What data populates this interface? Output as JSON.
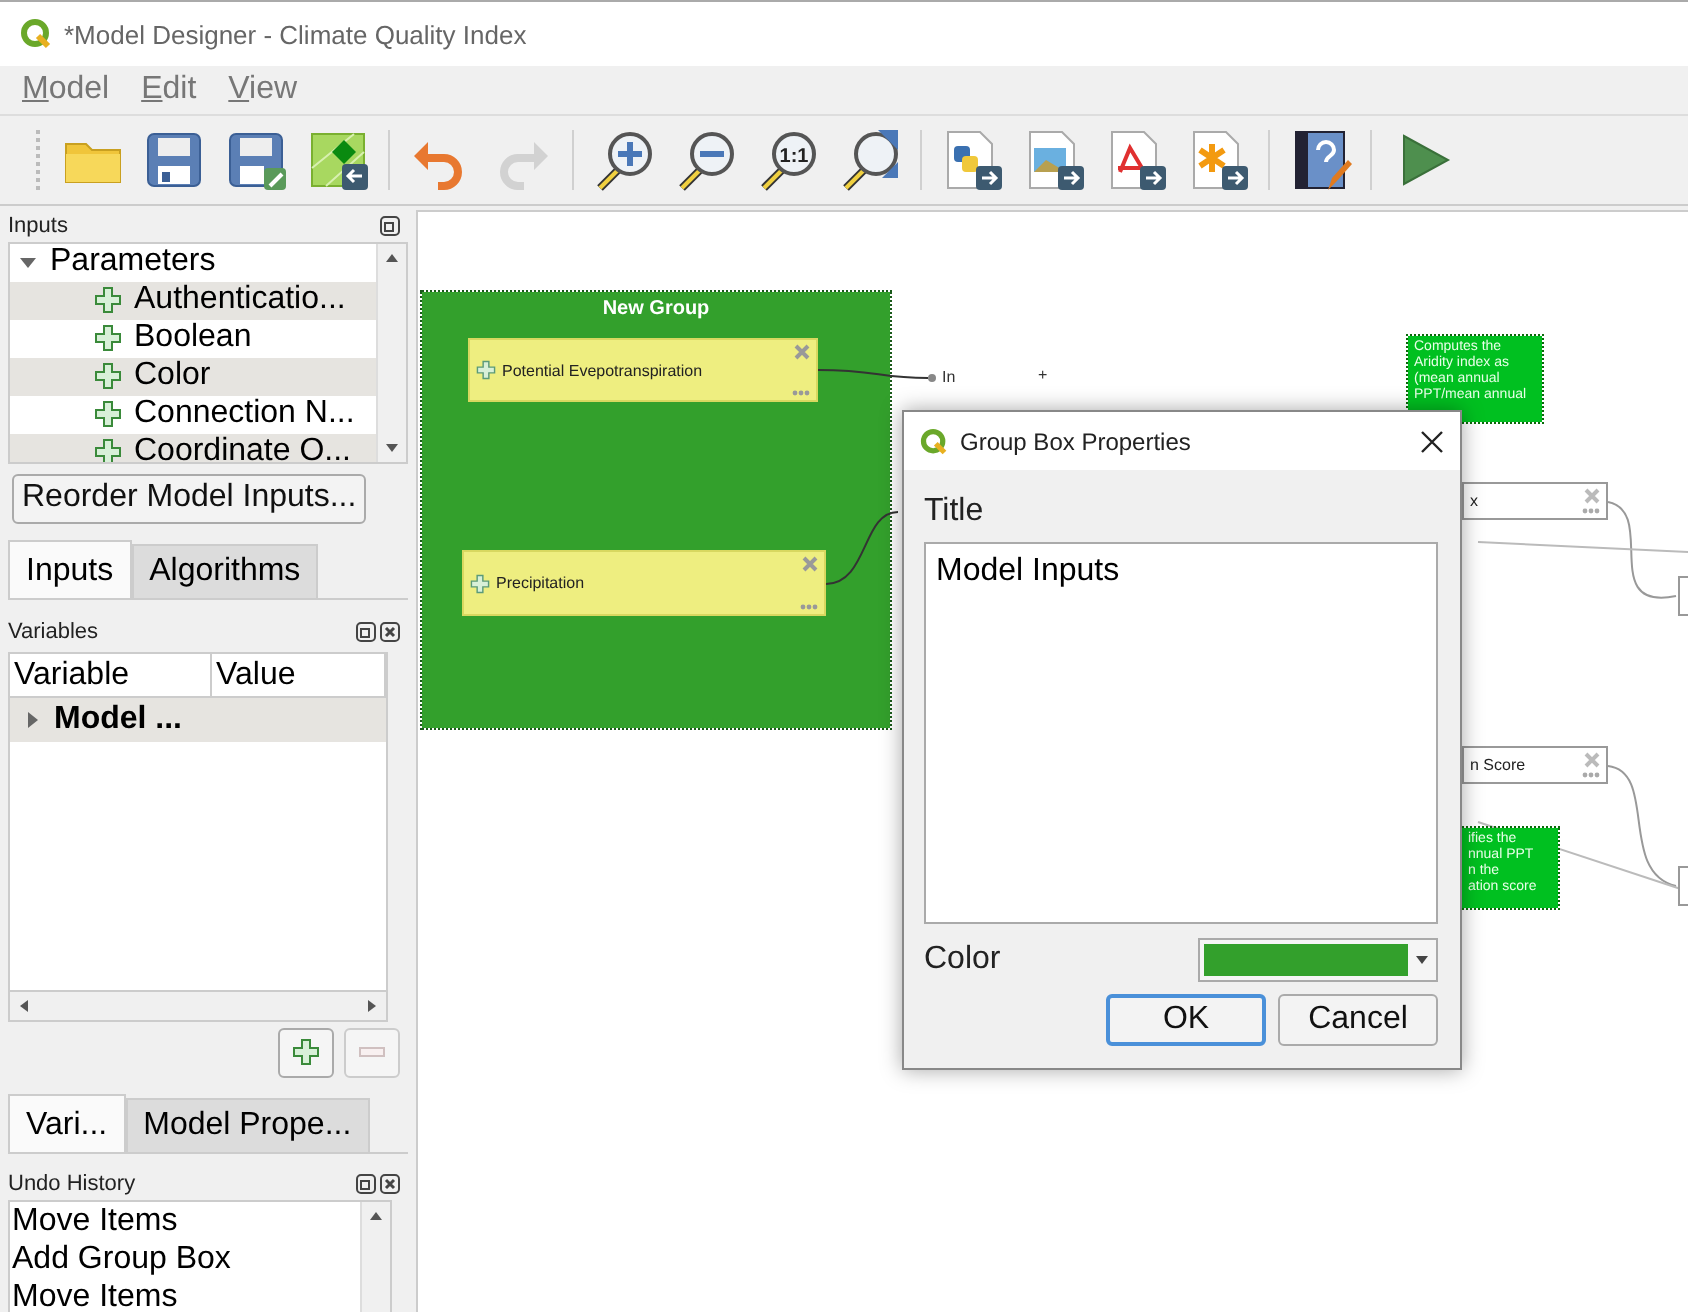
{
  "window": {
    "title": "*Model Designer - Climate Quality Index"
  },
  "menu": [
    "Model",
    "Edit",
    "View"
  ],
  "toolbar": [
    {
      "kind": "open",
      "disabled": false
    },
    {
      "kind": "save",
      "disabled": false
    },
    {
      "kind": "save-as",
      "disabled": false
    },
    {
      "kind": "export-model",
      "disabled": false
    },
    {
      "kind": "sep"
    },
    {
      "kind": "undo",
      "disabled": false
    },
    {
      "kind": "redo",
      "disabled": true
    },
    {
      "kind": "sep"
    },
    {
      "kind": "zoom-in",
      "disabled": false
    },
    {
      "kind": "zoom-out",
      "disabled": false
    },
    {
      "kind": "zoom-actual",
      "text": "1:1",
      "disabled": false
    },
    {
      "kind": "zoom-full",
      "disabled": false
    },
    {
      "kind": "sep"
    },
    {
      "kind": "export-python",
      "disabled": false
    },
    {
      "kind": "export-image",
      "disabled": false
    },
    {
      "kind": "export-pdf",
      "disabled": false
    },
    {
      "kind": "export-svg",
      "disabled": false
    },
    {
      "kind": "sep"
    },
    {
      "kind": "help",
      "disabled": false
    },
    {
      "kind": "sep"
    },
    {
      "kind": "run",
      "disabled": false
    }
  ],
  "inputs_panel": {
    "title": "Inputs",
    "tree": {
      "label": "Parameters",
      "expanded": true,
      "children": [
        {
          "label": "Authenticatio..."
        },
        {
          "label": "Boolean"
        },
        {
          "label": "Color"
        },
        {
          "label": "Connection N..."
        },
        {
          "label": "Coordinate O..."
        }
      ]
    },
    "reorder_button": "Reorder Model Inputs..."
  },
  "upper_tabs": [
    {
      "label": "Inputs",
      "selected": true
    },
    {
      "label": "Algorithms",
      "selected": false
    }
  ],
  "variables_panel": {
    "title": "Variables",
    "columns": [
      "Variable",
      "Value"
    ],
    "rows": [
      {
        "label": "Model ...",
        "expanded": false
      }
    ]
  },
  "lower_tabs": [
    {
      "label": "Vari...",
      "selected": true
    },
    {
      "label": "Model Prope...",
      "selected": false
    }
  ],
  "undo_panel": {
    "title": "Undo History",
    "items": [
      "Move Items",
      "Add Group Box",
      "Move Items"
    ]
  },
  "canvas": {
    "group": {
      "title": "New Group"
    },
    "nodes": [
      {
        "kind": "input",
        "label": "Potential Evepotranspiration"
      },
      {
        "kind": "input",
        "label": "Precipitation"
      },
      {
        "kind": "algorithm",
        "label": "x"
      },
      {
        "kind": "algorithm",
        "label": "n Score"
      },
      {
        "kind": "edge"
      },
      {
        "kind": "edge"
      }
    ],
    "comments": [
      {
        "lines": [
          "Computes the",
          "Aridity index as",
          "(mean annual",
          "PPT/mean annual"
        ]
      },
      {
        "lines": [
          "ifies the",
          "nnual PPT",
          "n the",
          "ation score"
        ]
      }
    ],
    "port_label": "In",
    "add_mark": "+"
  },
  "dialog": {
    "title": "Group Box Properties",
    "title_label": "Title",
    "title_value": "Model Inputs",
    "color_label": "Color",
    "color": "#33a02c",
    "buttons": [
      {
        "label": "OK",
        "focused": true
      },
      {
        "label": "Cancel",
        "focused": false
      }
    ]
  }
}
